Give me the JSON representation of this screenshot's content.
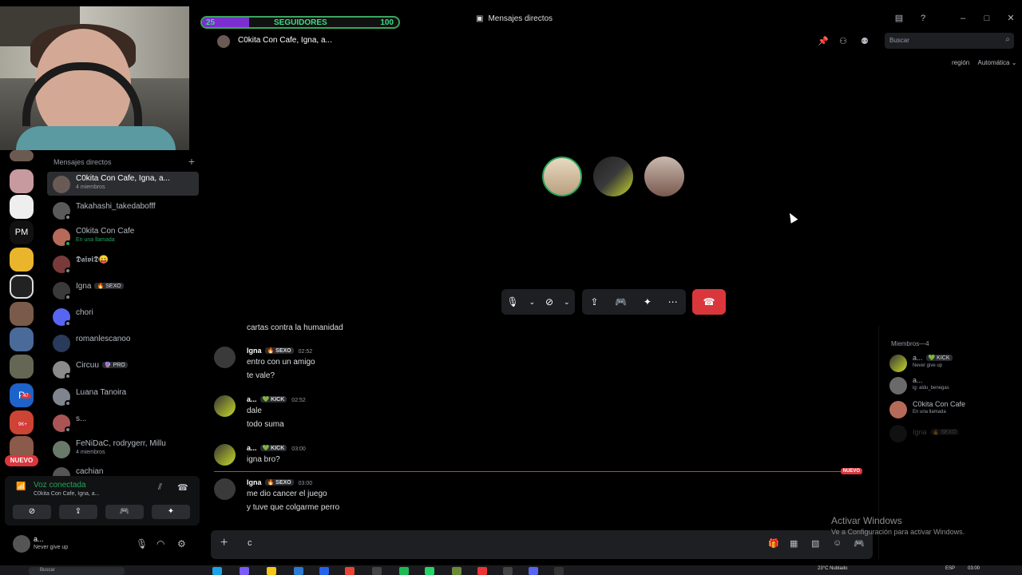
{
  "titlebar": {
    "followers": {
      "current": "25",
      "label": "SEGUIDORES",
      "goal": "100"
    },
    "dm_title": "Mensajes directos"
  },
  "sidebar": {
    "header": "Mensajes directos",
    "dms": [
      {
        "name": "C0kita Con Cafe, Igna, a...",
        "sub": "4 miembros"
      },
      {
        "name": "Takahashi_takedabofff",
        "sub": ""
      },
      {
        "name": "C0kita Con Cafe",
        "sub": "En una llamada"
      },
      {
        "name": "𝕯𝖆𝖎𝖛𝖎𝕯😛",
        "sub": ""
      },
      {
        "name": "Igna",
        "tag": "🔥 SEXO",
        "sub": ""
      },
      {
        "name": "chori",
        "sub": ""
      },
      {
        "name": "romanlescanoo",
        "sub": ""
      },
      {
        "name": "Circuu",
        "tag": "🔮 PRO",
        "sub": ""
      },
      {
        "name": "Luana Tanoira",
        "sub": ""
      },
      {
        "name": "s...",
        "sub": ""
      },
      {
        "name": "FeNiDaC, rodrygerr, Millu",
        "sub": "4 miembros"
      },
      {
        "name": "cachian",
        "sub": ""
      }
    ]
  },
  "rail": {
    "pm_label": "PM",
    "nuevo": "NUEVO",
    "badge_47": "47",
    "badge_9k": "9K+"
  },
  "voice": {
    "title": "Voz conectada",
    "sub": "C0kita Con Cafe, Igna, a..."
  },
  "user": {
    "name": "a...",
    "sub": "Never give up"
  },
  "call": {
    "title": "C0kita Con Cafe, Igna, a...",
    "search_placeholder": "Buscar",
    "region_label": "región",
    "region_value": "Automática"
  },
  "chat": {
    "top_line": "cartas contra la humanidad",
    "messages": [
      {
        "author": "Igna",
        "tag": "🔥 SEXO",
        "time": "02:52",
        "lines": [
          "entro con un amigo",
          "te vale?"
        ]
      },
      {
        "author": "a...",
        "tag": "💚 KICK",
        "time": "02:52",
        "lines": [
          "dale",
          "todo suma"
        ]
      },
      {
        "author": "a...",
        "tag": "💚 KICK",
        "time": "03:00",
        "lines": [
          "igna bro?"
        ]
      },
      {
        "author": "Igna",
        "tag": "🔥 SEXO",
        "time": "03:00",
        "lines": [
          "me dio cancer el juego",
          "y tuve que colgarme perro"
        ]
      }
    ],
    "new_label": "NUEVO",
    "composer_value": "c"
  },
  "members": {
    "header": "Miembros—4",
    "list": [
      {
        "name": "a...",
        "tag": "💚 KICK",
        "sub": "Never give up"
      },
      {
        "name": "a...",
        "tag": "",
        "sub": "ig: aldu_benegas"
      },
      {
        "name": "C0kita Con Cafe",
        "tag": "",
        "sub": "En una llamada"
      },
      {
        "name": "Igna",
        "tag": "🔥 SEXO",
        "sub": ""
      }
    ]
  },
  "watermark": {
    "title": "Activar Windows",
    "sub": "Ve a Configuración para activar Windows."
  },
  "taskbar": {
    "search": "Buscar",
    "temp": "23°C  Nublado",
    "lang": "ESP",
    "time": "03:00"
  }
}
